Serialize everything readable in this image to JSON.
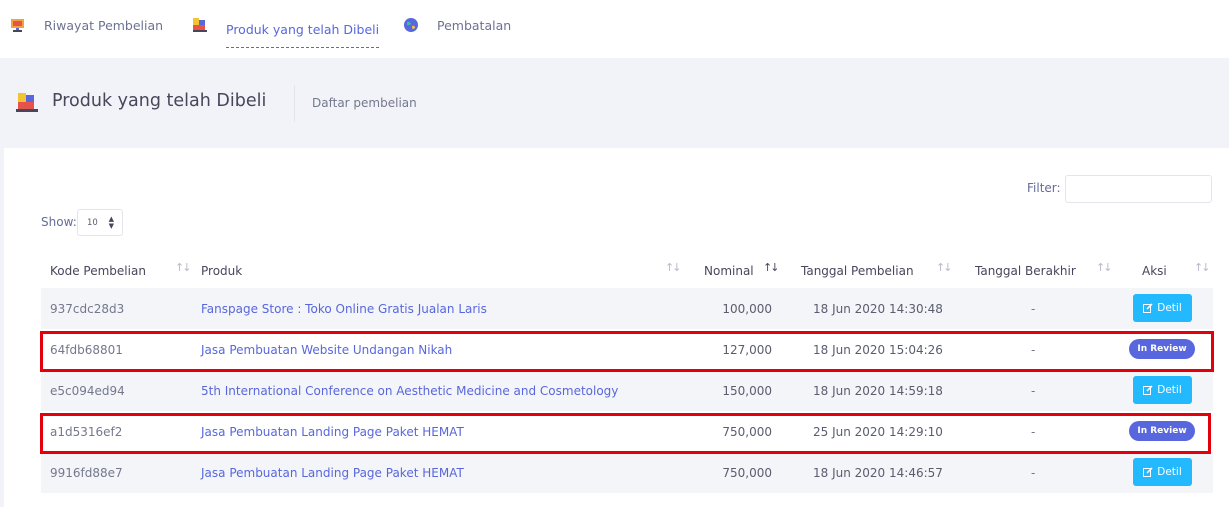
{
  "tabs": [
    {
      "label": "Riwayat Pembelian",
      "icon": "monitor-icon"
    },
    {
      "label": "Produk yang telah Dibeli",
      "icon": "cube-icon",
      "active": true
    },
    {
      "label": "Pembatalan",
      "icon": "globe-icon"
    }
  ],
  "header": {
    "title": "Produk yang telah Dibeli",
    "description": "Daftar pembelian"
  },
  "controls": {
    "filter_label": "Filter:",
    "filter_value": "",
    "show_label": "Show:",
    "show_value": "10"
  },
  "table": {
    "columns": [
      "Kode Pembelian",
      "Produk",
      "Nominal",
      "Tanggal Pembelian",
      "Tanggal Berakhir",
      "Aksi"
    ],
    "rows": [
      {
        "code": "937cdc28d3",
        "product": "Fanspage Store : Toko Online Gratis Jualan Laris",
        "nominal": "100,000",
        "date": "18 Jun 2020 14:30:48",
        "end": "-",
        "action": "Detil",
        "action_type": "button"
      },
      {
        "code": "64fdb68801",
        "product": "Jasa Pembuatan Website Undangan Nikah",
        "nominal": "127,000",
        "date": "18 Jun 2020 15:04:26",
        "end": "-",
        "action": "In Review",
        "action_type": "badge"
      },
      {
        "code": "e5c094ed94",
        "product": "5th International Conference on Aesthetic Medicine and Cosmetology",
        "nominal": "150,000",
        "date": "18 Jun 2020 14:59:18",
        "end": "-",
        "action": "Detil",
        "action_type": "button"
      },
      {
        "code": "a1d5316ef2",
        "product": "Jasa Pembuatan Landing Page Paket HEMAT",
        "nominal": "750,000",
        "date": "25 Jun 2020 14:29:10",
        "end": "-",
        "action": "In Review",
        "action_type": "badge"
      },
      {
        "code": "9916fd88e7",
        "product": "Jasa Pembuatan Landing Page Paket HEMAT",
        "nominal": "750,000",
        "date": "18 Jun 2020 14:46:57",
        "end": "-",
        "action": "Detil",
        "action_type": "button"
      }
    ]
  },
  "colors": {
    "accent": "#5867dd",
    "button": "#22b9ff",
    "highlight": "#e3000b"
  }
}
